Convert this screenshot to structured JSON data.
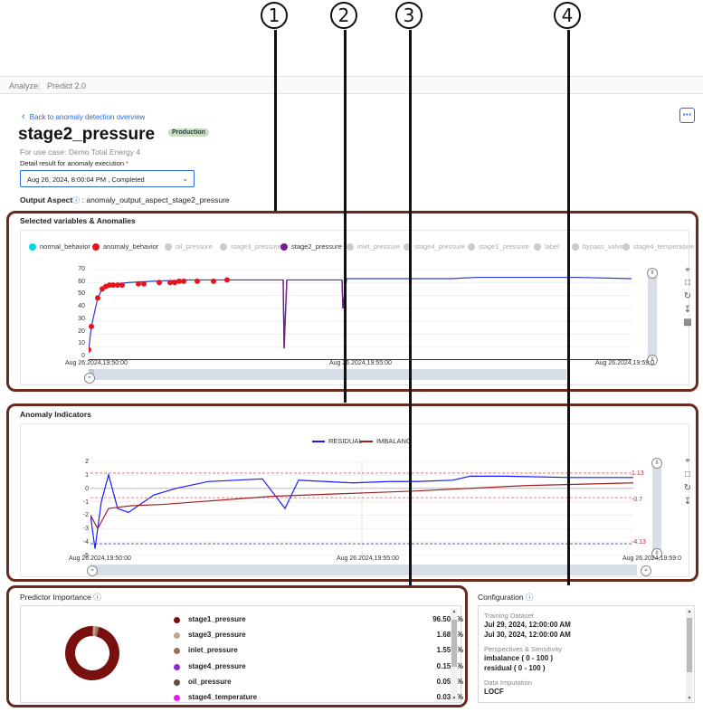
{
  "callouts": [
    "1",
    "2",
    "3",
    "4"
  ],
  "breadcrumb": {
    "items": [
      "Analyze",
      "Predict 2.0"
    ]
  },
  "back_link": "Back to anomaly detection overview",
  "more_icon": "more-dots-icon",
  "title": "stage2_pressure",
  "badge": "Production",
  "use_case": "For use case: Demo Total Energy 4",
  "detail_label": "Detail result for anomaly execution",
  "required_mark": "*",
  "execution_select": {
    "value": "Aug 26, 2024, 8:00:04 PM , Completed"
  },
  "output_aspect_label": "Output Aspect",
  "output_aspect_value": ": anomaly_output_aspect_stage2_pressure",
  "panel1": {
    "title": "Selected variables & Anomalies",
    "legend": [
      {
        "label": "normal_behavior",
        "color": "#00d9e8",
        "active": true
      },
      {
        "label": "anomaly_behavior",
        "color": "#e8141c",
        "active": true
      },
      {
        "label": "oil_pressure",
        "color": "#cccccc",
        "active": false
      },
      {
        "label": "stage3_pressure",
        "color": "#cccccc",
        "active": false
      },
      {
        "label": "stage2_pressure",
        "color": "#7a1a8a",
        "active": true
      },
      {
        "label": "inlet_pressure",
        "color": "#cccccc",
        "active": false
      },
      {
        "label": "stage4_pressure",
        "color": "#cccccc",
        "active": false
      },
      {
        "label": "stage1_pressure",
        "color": "#cccccc",
        "active": false
      },
      {
        "label": "label",
        "color": "#cccccc",
        "active": false
      },
      {
        "label": "bypass_valve",
        "color": "#cccccc",
        "active": false
      },
      {
        "label": "stage4_temperature",
        "color": "#cccccc",
        "active": false
      }
    ],
    "yticks": [
      "70",
      "60",
      "50",
      "40",
      "30",
      "20",
      "10",
      "0"
    ],
    "xticks": [
      "Aug 26.2024,19:50:00",
      "Aug 26.2024,19:55:00",
      "Aug 26.2024,19:59:0"
    ]
  },
  "panel2": {
    "title": "Anomaly Indicators",
    "legend": [
      {
        "label": "RESIDUAL",
        "color": "#1a1aff"
      },
      {
        "label": "IMBALANC",
        "color": "#a02020"
      }
    ],
    "yticks": [
      "2",
      "1",
      "0",
      "-1",
      "-2",
      "-3",
      "-4",
      "-5"
    ],
    "xticks": [
      "Aug 26.2024,19:50:00",
      "Aug 26.2024,19:55:00",
      "Aug 26.2024,19:59:0"
    ],
    "thresholds": [
      "1.13",
      "-0.7",
      "-4.13"
    ]
  },
  "predictor_importance": {
    "title": "Predictor Importance",
    "rows": [
      {
        "name": "stage1_pressure",
        "value": "96.509 %",
        "color": "#7a0f0f",
        "fraction": 0.96509
      },
      {
        "name": "stage3_pressure",
        "value": "1.689 %",
        "color": "#b8a98a",
        "fraction": 0.01689
      },
      {
        "name": "inlet_pressure",
        "value": "1.556 %",
        "color": "#a07050",
        "fraction": 0.01556
      },
      {
        "name": "stage4_pressure",
        "value": "0.154 %",
        "color": "#8a2ad0",
        "fraction": 0.00154
      },
      {
        "name": "oil_pressure",
        "value": "0.055 %",
        "color": "#6a4a3a",
        "fraction": 0.00055
      },
      {
        "name": "stage4_temperature",
        "value": "0.034 %",
        "color": "#e020e0",
        "fraction": 0.00034
      }
    ]
  },
  "configuration": {
    "title": "Configuration",
    "sections": [
      {
        "label": "Training Dataset",
        "values": [
          "Jul 29, 2024, 12:00:00 AM",
          "Jul 30, 2024, 12:00:00 AM"
        ]
      },
      {
        "label": "Perspectives & Sensitivity",
        "values": [
          "imbalance ( 0 - 100 )",
          "residual ( 0 - 100 )"
        ]
      },
      {
        "label": "Data Imputation",
        "values": [
          "LOCF"
        ]
      }
    ]
  },
  "chart_data": [
    {
      "type": "line",
      "title": "Selected variables & Anomalies",
      "ylim": [
        0,
        70
      ],
      "x": [
        "19:50:00",
        "19:55:00",
        "19:59:0"
      ],
      "series": [
        {
          "name": "stage2_pressure",
          "values": [
            8,
            26,
            48,
            55,
            58,
            59,
            60,
            61,
            62,
            62,
            62,
            62,
            9,
            62,
            62,
            40,
            63,
            63,
            63,
            63,
            63,
            64,
            64,
            64,
            64,
            63
          ]
        },
        {
          "name": "anomaly_behavior",
          "values": [
            8,
            26,
            48,
            55,
            57,
            58,
            58,
            58,
            58,
            59,
            59,
            60,
            60,
            60,
            61,
            61,
            61,
            61,
            62
          ]
        }
      ]
    },
    {
      "type": "line",
      "title": "Anomaly Indicators",
      "ylim": [
        -5,
        2
      ],
      "x": [
        "19:50:00",
        "19:55:00",
        "19:59:0"
      ],
      "series": [
        {
          "name": "RESIDUAL",
          "values": [
            -2,
            -4.5,
            -1,
            1,
            -1.5,
            -1.8,
            -0.5,
            0,
            0.5,
            0.6,
            0.7,
            -1.5,
            0.6,
            0.4,
            0.5,
            0.5,
            0.6,
            0.9,
            0.9,
            0.8,
            0.8
          ]
        },
        {
          "name": "IMBALANC",
          "values": [
            -2,
            -3,
            -1.5,
            -1.3,
            -1.2,
            -1,
            -0.8,
            -0.6,
            -0.5,
            -0.4,
            -0.3,
            -0.2,
            0,
            0.2,
            0.3,
            0.4
          ]
        }
      ],
      "thresholds": [
        1.13,
        -0.7,
        -4.13
      ]
    },
    {
      "type": "pie",
      "title": "Predictor Importance",
      "categories": [
        "stage1_pressure",
        "stage3_pressure",
        "inlet_pressure",
        "stage4_pressure",
        "oil_pressure",
        "stage4_temperature"
      ],
      "values": [
        96.509,
        1.689,
        1.556,
        0.154,
        0.055,
        0.034
      ]
    }
  ]
}
